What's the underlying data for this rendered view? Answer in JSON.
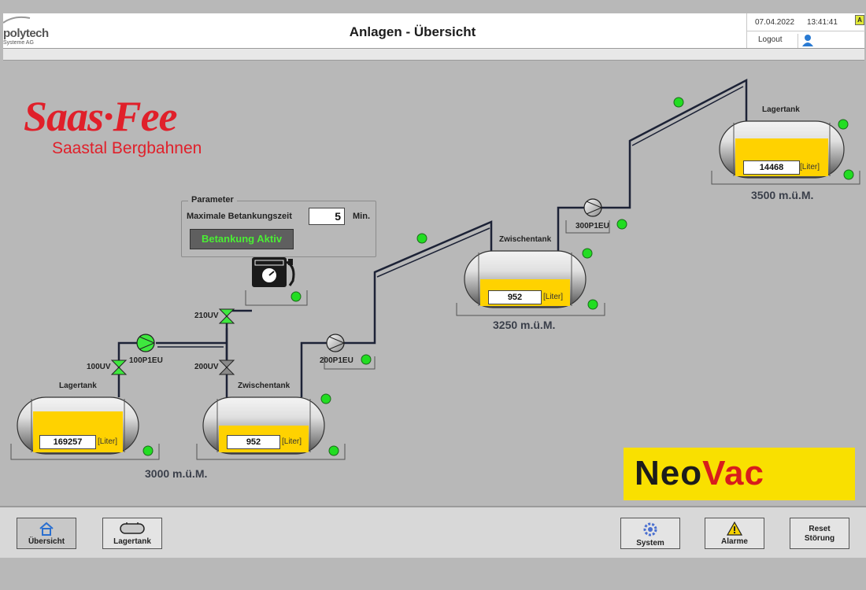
{
  "header": {
    "brand_name": "polytech",
    "brand_sub": "Systeme AG",
    "title": "Anlagen - Übersicht",
    "date": "07.04.2022",
    "time": "13:41:41",
    "logout": "Logout",
    "badge": "A"
  },
  "logos": {
    "saasfee_main": "Saas·Fee",
    "saasfee_sub": "Saastal Bergbahnen",
    "neovac_a": "Neo",
    "neovac_b": "Vac"
  },
  "parameter": {
    "title": "Parameter",
    "label": "Maximale Betankungszeit",
    "value": "5",
    "unit": "Min.",
    "status_button": "Betankung Aktiv"
  },
  "tanks": [
    {
      "name": "Lagertank",
      "value": "169257",
      "unit": "[Liter]"
    },
    {
      "name": "Zwischentank",
      "value": "952",
      "unit": "[Liter]"
    },
    {
      "name": "Zwischentank",
      "value": "952",
      "unit": "[Liter]"
    },
    {
      "name": "Lagertank",
      "value": "14468",
      "unit": "[Liter]"
    }
  ],
  "valves": {
    "v100": "100UV",
    "v200": "200UV",
    "v210": "210UV"
  },
  "pumps": {
    "p100": "100P1EU",
    "p200": "200P1EU",
    "p300": "300P1EU"
  },
  "altitudes": {
    "a3000": "3000 m.ü.M.",
    "a3250": "3250 m.ü.M.",
    "a3500": "3500 m.ü.M."
  },
  "nav": {
    "overview": "Übersicht",
    "storage": "Lagertank",
    "system": "System",
    "alarms": "Alarme",
    "reset_1": "Reset",
    "reset_2": "Störung"
  },
  "colors": {
    "status_ok": "#22dd22",
    "fill": "#ffd200",
    "pipe": "#1c2236"
  }
}
